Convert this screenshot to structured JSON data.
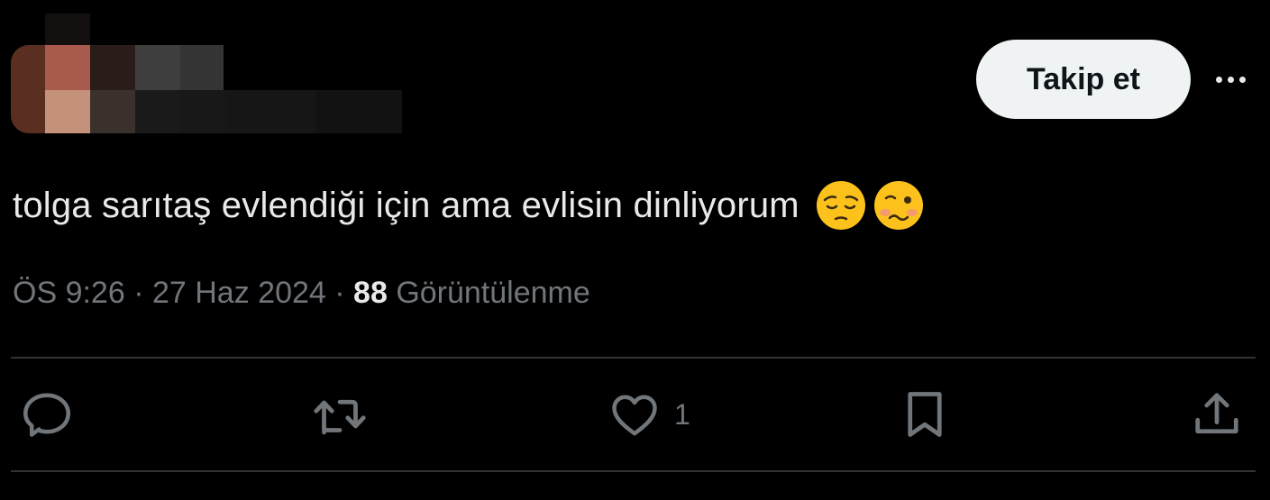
{
  "header": {
    "follow_label": "Takip et",
    "more_icon": "more-horizontal-icon"
  },
  "tweet": {
    "text": "tolga sarıtaş evlendiği için ama evlisin dinliyorum",
    "emojis": [
      "pensive-face-emoji",
      "woozy-face-emoji"
    ],
    "time": "ÖS 9:26",
    "separator": "·",
    "date": "27 Haz 2024",
    "views_count": "88",
    "views_label": "Görüntülenme"
  },
  "actions": {
    "reply_icon": "reply-icon",
    "retweet_icon": "retweet-icon",
    "like_icon": "heart-icon",
    "like_count": "1",
    "bookmark_icon": "bookmark-icon",
    "share_icon": "share-icon"
  },
  "colors": {
    "background": "#000000",
    "text_primary": "#e7e9ea",
    "text_secondary": "#71767b",
    "button_bg": "#eff3f4",
    "divider": "#2f3336"
  }
}
